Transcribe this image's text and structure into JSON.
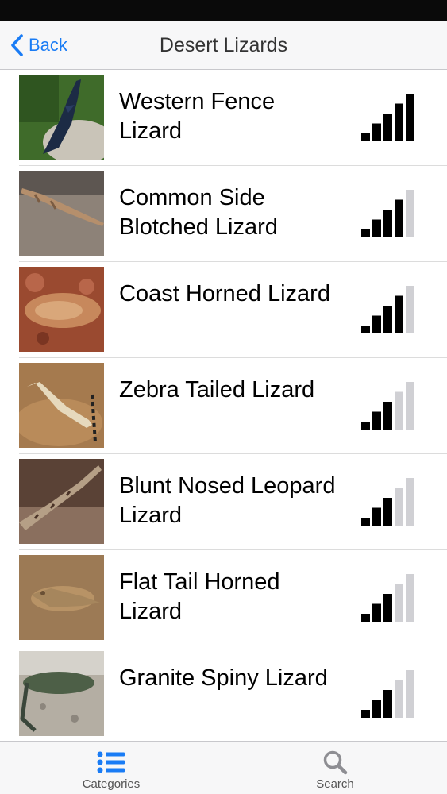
{
  "nav": {
    "back_label": "Back",
    "title": "Desert Lizards"
  },
  "lizards": [
    {
      "name": "Western Fence Lizard",
      "signal_level": 5,
      "signal_max": 5
    },
    {
      "name": "Common Side Blotched Lizard",
      "signal_level": 4,
      "signal_max": 5
    },
    {
      "name": "Coast Horned Lizard",
      "signal_level": 4,
      "signal_max": 5
    },
    {
      "name": "Zebra Tailed Lizard",
      "signal_level": 3,
      "signal_max": 5
    },
    {
      "name": "Blunt Nosed Leopard Lizard",
      "signal_level": 3,
      "signal_max": 5
    },
    {
      "name": "Flat Tail Horned Lizard",
      "signal_level": 3,
      "signal_max": 5
    },
    {
      "name": "Granite Spiny Lizard",
      "signal_level": 3,
      "signal_max": 5
    }
  ],
  "tabs": {
    "categories_label": "Categories",
    "search_label": "Search"
  },
  "colors": {
    "accent": "#1a7cf5",
    "signal_on": "#000000",
    "signal_off": "#d0d0d4"
  }
}
